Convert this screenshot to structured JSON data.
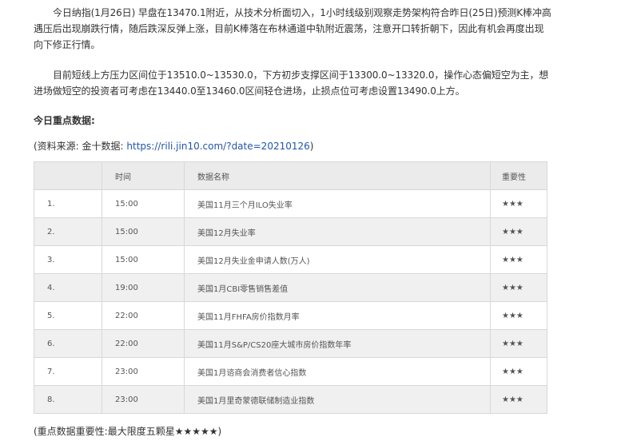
{
  "article": {
    "para1": "今日纳指(1月26日) 早盘在13470.1附近，从技术分析面切入，1小时线级别观察走势架构符合昨日(25日)预测K棒冲高遇压后出现崩跌行情，随后跌深反弹上涨，目前K棒落在布林通道中轨附近震荡，注意开口转折朝下，因此有机会再度出现向下修正行情。",
    "para2": "目前短线上方压力区间位于13510.0~13530.0，下方初步支撑区间于13300.0~13320.0，操作心态偏短空为主，想进场做短空的投资者可考虑在13440.0至13460.0区间轻仓进场，止损点位可考虑设置13490.0上方。",
    "section_title": "今日重点数据:",
    "source_prefix": "(资料来源: 金十数据: ",
    "source_link": "https://rili.jin10.com/?date=20210126",
    "source_suffix": ")",
    "footnote": "(重点数据重要性:最大限度五颗星★★★★★)"
  },
  "table": {
    "headers": [
      "",
      "时间",
      "数据名称",
      "重要性"
    ],
    "rows": [
      {
        "no": "1.",
        "time": "15:00",
        "name": "美国11月三个月ILO失业率",
        "importance": "★★★"
      },
      {
        "no": "2.",
        "time": "15:00",
        "name": "美国12月失业率",
        "importance": "★★★"
      },
      {
        "no": "3.",
        "time": "15:00",
        "name": "美国12月失业金申请人数(万人)",
        "importance": "★★★"
      },
      {
        "no": "4.",
        "time": "19:00",
        "name": "美国1月CBI零售销售差值",
        "importance": "★★★"
      },
      {
        "no": "5.",
        "time": "22:00",
        "name": "美国11月FHFA房价指数月率",
        "importance": "★★★"
      },
      {
        "no": "6.",
        "time": "22:00",
        "name": "美国11月S&P/CS20座大城市房价指数年率",
        "importance": "★★★"
      },
      {
        "no": "7.",
        "time": "23:00",
        "name": "美国1月谘商会消费者信心指数",
        "importance": "★★★"
      },
      {
        "no": "8.",
        "time": "23:00",
        "name": "美国1月里奇蒙德联储制造业指数",
        "importance": "★★★"
      }
    ]
  }
}
